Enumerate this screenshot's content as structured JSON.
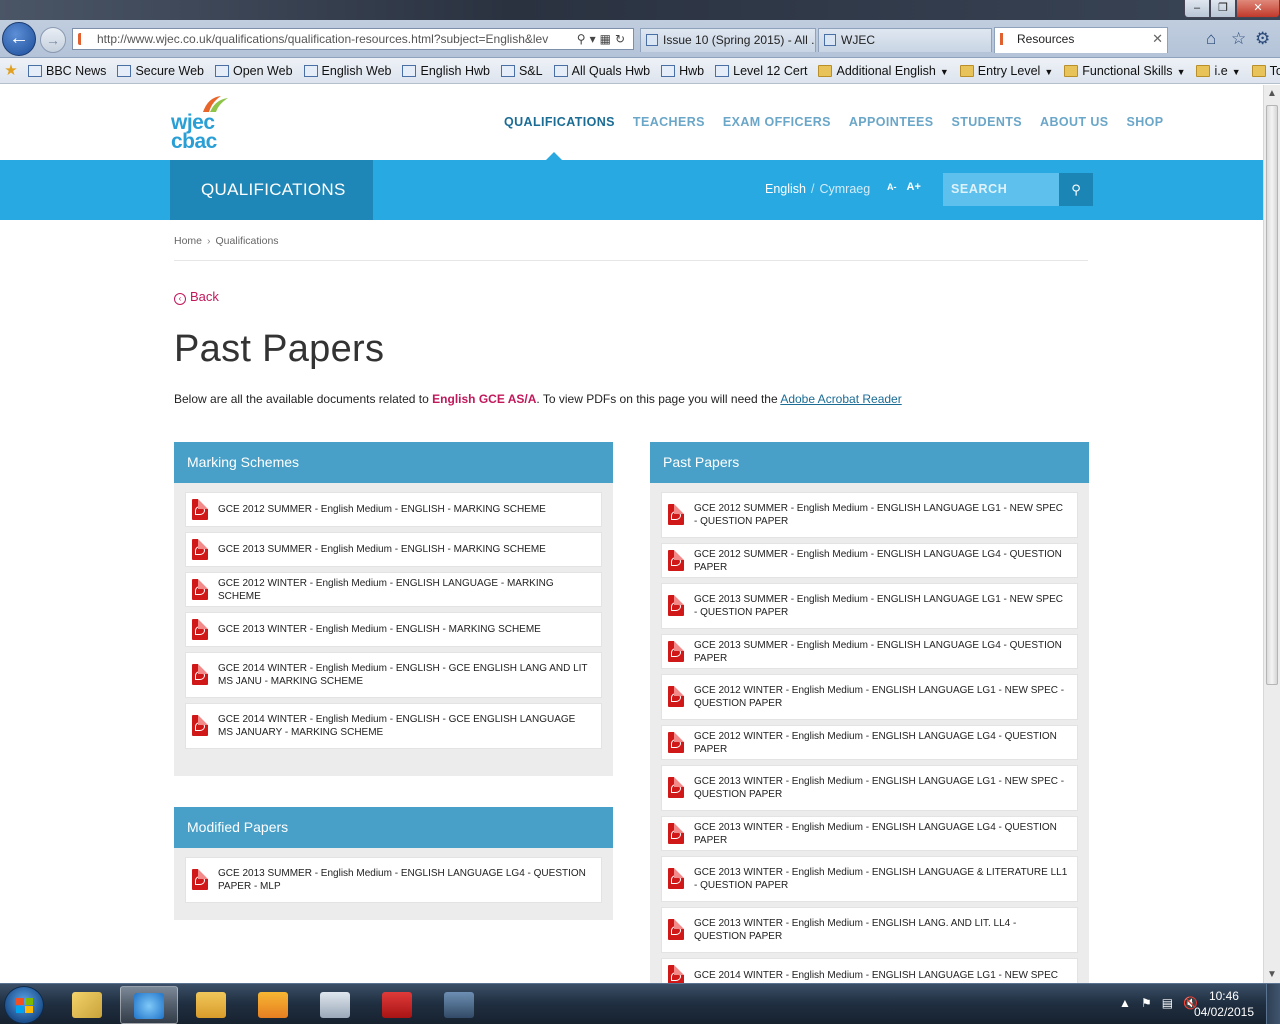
{
  "browser": {
    "address": "http://www.wjec.co.uk/qualifications/qualification-resources.html?subject=English&lev",
    "tabs": [
      {
        "label": "Issue 10 (Spring 2015) - All ..."
      },
      {
        "label": "WJEC"
      },
      {
        "label": "Resources",
        "active": true
      }
    ],
    "favorites": [
      {
        "label": "BBC News",
        "type": "link",
        "icon": "bbc-icon"
      },
      {
        "label": "Secure Web",
        "type": "link",
        "icon": "page-icon"
      },
      {
        "label": "Open Web",
        "type": "link",
        "icon": "page-icon"
      },
      {
        "label": "English Web",
        "type": "link",
        "icon": "page-icon"
      },
      {
        "label": "English Hwb",
        "type": "link",
        "icon": "page-icon"
      },
      {
        "label": "S&L",
        "type": "link",
        "icon": "page-icon"
      },
      {
        "label": "All Quals Hwb",
        "type": "link",
        "icon": "page-icon"
      },
      {
        "label": "Hwb",
        "type": "link",
        "icon": "ie-icon"
      },
      {
        "label": "Level 12 Cert",
        "type": "link",
        "icon": "page-icon"
      },
      {
        "label": "Additional English",
        "type": "folder",
        "icon": "folder-icon"
      },
      {
        "label": "Entry Level",
        "type": "folder",
        "icon": "folder-icon"
      },
      {
        "label": "Functional Skills",
        "type": "folder",
        "icon": "folder-icon"
      },
      {
        "label": "i.e",
        "type": "folder",
        "icon": "folder-icon"
      },
      {
        "label": "Tools",
        "type": "folder",
        "icon": "folder-icon"
      }
    ]
  },
  "site": {
    "logo": {
      "line1": "wjec",
      "line2": "cbac"
    },
    "nav": [
      {
        "label": "QUALIFICATIONS",
        "active": true
      },
      {
        "label": "TEACHERS"
      },
      {
        "label": "EXAM OFFICERS"
      },
      {
        "label": "APPOINTEES"
      },
      {
        "label": "STUDENTS"
      },
      {
        "label": "ABOUT US"
      },
      {
        "label": "SHOP"
      }
    ],
    "section_title": "QUALIFICATIONS",
    "lang": {
      "current": "English",
      "separator": "/",
      "other": "Cymraeg"
    },
    "text_size": {
      "smaller": "A-",
      "larger": "A+"
    },
    "search": {
      "placeholder": "SEARCH"
    },
    "breadcrumb": {
      "home": "Home",
      "sep": "›",
      "current": "Qualifications"
    },
    "back_label": "Back",
    "page_title": "Past Papers",
    "intro": {
      "before": "Below are all the available documents related to ",
      "subject": "English GCE AS/A",
      "middle": ". To view PDFs on this page you will need the ",
      "link": "Adobe Acrobat Reader"
    }
  },
  "panels": {
    "marking": {
      "title": "Marking Schemes",
      "items": [
        {
          "label": "GCE 2012 SUMMER - English Medium - ENGLISH - MARKING SCHEME"
        },
        {
          "label": "GCE 2013 SUMMER - English Medium - ENGLISH - MARKING SCHEME"
        },
        {
          "label": "GCE 2012 WINTER - English Medium - ENGLISH LANGUAGE - MARKING SCHEME"
        },
        {
          "label": "GCE 2013 WINTER - English Medium - ENGLISH - MARKING SCHEME"
        },
        {
          "label": "GCE 2014 WINTER - English Medium - ENGLISH - GCE ENGLISH LANG AND LIT MS JANU - MARKING SCHEME"
        },
        {
          "label": "GCE 2014 WINTER - English Medium - ENGLISH - GCE ENGLISH LANGUAGE MS JANUARY - MARKING SCHEME"
        }
      ]
    },
    "modified": {
      "title": "Modified Papers",
      "items": [
        {
          "label": "GCE 2013 SUMMER - English Medium - ENGLISH LANGUAGE LG4 - QUESTION PAPER - MLP"
        }
      ]
    },
    "past": {
      "title": "Past Papers",
      "items": [
        {
          "label": "GCE 2012 SUMMER - English Medium - ENGLISH LANGUAGE LG1 - NEW SPEC - QUESTION PAPER"
        },
        {
          "label": "GCE 2012 SUMMER - English Medium - ENGLISH LANGUAGE LG4 - QUESTION PAPER"
        },
        {
          "label": "GCE 2013 SUMMER - English Medium - ENGLISH LANGUAGE LG1 - NEW SPEC - QUESTION PAPER"
        },
        {
          "label": "GCE 2013 SUMMER - English Medium - ENGLISH LANGUAGE LG4 - QUESTION PAPER"
        },
        {
          "label": "GCE 2012 WINTER - English Medium - ENGLISH LANGUAGE LG1 - NEW SPEC - QUESTION PAPER"
        },
        {
          "label": "GCE 2012 WINTER - English Medium - ENGLISH LANGUAGE LG4 - QUESTION PAPER"
        },
        {
          "label": "GCE 2013 WINTER - English Medium - ENGLISH LANGUAGE LG1 - NEW SPEC - QUESTION PAPER"
        },
        {
          "label": "GCE 2013 WINTER - English Medium - ENGLISH LANGUAGE LG4 - QUESTION PAPER"
        },
        {
          "label": "GCE 2013 WINTER - English Medium - ENGLISH LANGUAGE & LITERATURE LL1 - QUESTION PAPER"
        },
        {
          "label": "GCE 2013 WINTER - English Medium - ENGLISH LANG. AND LIT. LL4 - QUESTION PAPER"
        },
        {
          "label": "GCE 2014 WINTER - English Medium - ENGLISH LANGUAGE LG1 - NEW SPEC"
        }
      ]
    }
  },
  "taskbar": {
    "apps": [
      {
        "name": "explorer-files-icon"
      },
      {
        "name": "internet-explorer-icon",
        "active": true
      },
      {
        "name": "file-manager-icon"
      },
      {
        "name": "outlook-icon"
      },
      {
        "name": "calculator-icon"
      },
      {
        "name": "adobe-reader-icon"
      },
      {
        "name": "remote-desktop-icon"
      }
    ],
    "clock": {
      "time": "10:46",
      "date": "04/02/2015"
    }
  },
  "colors": {
    "brand_blue": "#29a9e1",
    "section_blue": "#1f87b7",
    "panel_head": "#48a0c8",
    "accent_pink": "#c2185b",
    "pdf_red": "#d01818"
  }
}
